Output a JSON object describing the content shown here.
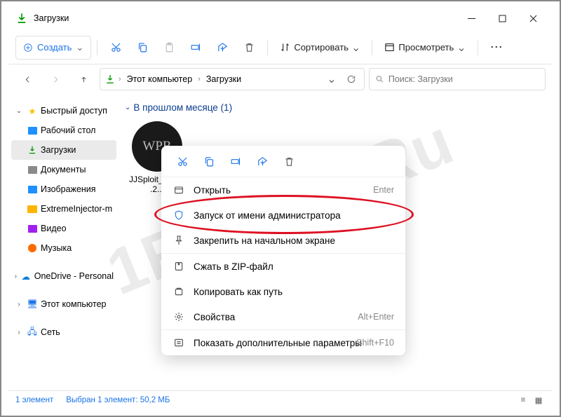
{
  "window": {
    "title": "Загрузки",
    "minimize": "–",
    "maximize": "☐",
    "close": "✕"
  },
  "toolbar": {
    "create": "Создать",
    "sort": "Сортировать",
    "view": "Просмотреть",
    "more": "⋯"
  },
  "breadcrumbs": {
    "pc": "Этот компьютер",
    "downloads": "Загрузки"
  },
  "search": {
    "placeholder": "Поиск: Загрузки"
  },
  "sidebar": {
    "quick": "Быстрый доступ",
    "items": [
      {
        "label": "Рабочий стол",
        "color": "#1e90ff"
      },
      {
        "label": "Загрузки",
        "color": "#009800",
        "selected": true
      },
      {
        "label": "Документы",
        "color": "#8a8a8a"
      },
      {
        "label": "Изображения",
        "color": "#1e90ff"
      },
      {
        "label": "ExtremeInjector-m",
        "color": "#ffb400",
        "folder": true
      },
      {
        "label": "Видео",
        "color": "#a020f0"
      },
      {
        "label": "Музыка",
        "color": "#ff6a00",
        "round": true
      }
    ],
    "onedrive": "OneDrive - Personal",
    "thispc": "Этот компьютер",
    "network": "Сеть"
  },
  "group": {
    "header": "В прошлом месяце (1)"
  },
  "file": {
    "name": "JJSploit_Setup\n.2...",
    "thumb_text": "WPR"
  },
  "ctx": {
    "items": [
      {
        "label": "Открыть",
        "shortcut": "Enter",
        "icon": "open"
      },
      {
        "label": "Запуск от имени администратора",
        "icon": "shield"
      },
      {
        "label": "Закрепить на начальном экране",
        "icon": "pin"
      },
      {
        "label": "Сжать в ZIP-файл",
        "icon": "zip"
      },
      {
        "label": "Копировать как путь",
        "icon": "copypath"
      },
      {
        "label": "Свойства",
        "shortcut": "Alt+Enter",
        "icon": "props"
      },
      {
        "label": "Показать дополнительные параметры",
        "shortcut": "Shift+F10",
        "icon": "more"
      }
    ]
  },
  "status": {
    "count": "1 элемент",
    "selected": "Выбран 1 элемент: 50,2 МБ"
  },
  "watermark": "1Roblox.Ru"
}
